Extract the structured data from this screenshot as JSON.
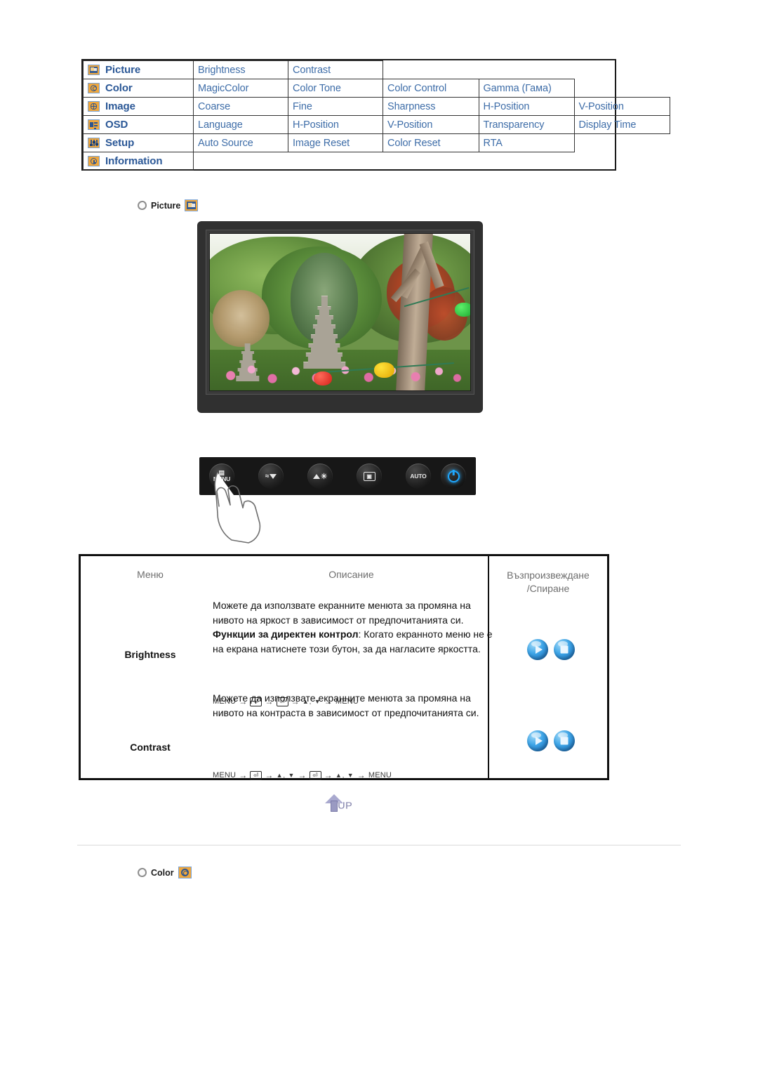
{
  "menu_map": {
    "rows": [
      {
        "category": "Picture",
        "icon": "picture-icon",
        "items": [
          "Brightness",
          "Contrast"
        ]
      },
      {
        "category": "Color",
        "icon": "color-icon",
        "items": [
          "MagicColor",
          "Color Tone",
          "Color Control",
          "Gamma (Гама)"
        ]
      },
      {
        "category": "Image",
        "icon": "image-icon",
        "items": [
          "Coarse",
          "Fine",
          "Sharpness",
          "H-Position",
          "V-Position"
        ]
      },
      {
        "category": "OSD",
        "icon": "osd-icon",
        "items": [
          "Language",
          "H-Position",
          "V-Position",
          "Transparency",
          "Display Time"
        ]
      },
      {
        "category": "Setup",
        "icon": "setup-icon",
        "items": [
          "Auto Source",
          "Image Reset",
          "Color Reset",
          "RTA"
        ]
      },
      {
        "category": "Information",
        "icon": "information-icon",
        "items": []
      }
    ],
    "link_color": "#3e6da8"
  },
  "section_picture": {
    "label": "Picture",
    "icon": "picture-icon",
    "bullet": "gem-bullet-icon"
  },
  "section_color": {
    "label": "Color",
    "icon": "color-icon",
    "bullet": "gem-bullet-icon"
  },
  "monitor": {
    "screen_alt": "garden scene with stone pagoda, trees and paper lanterns"
  },
  "button_bar": {
    "buttons": [
      {
        "name": "menu-button",
        "label": "MENU"
      },
      {
        "name": "down-button",
        "label": ""
      },
      {
        "name": "brightness-button",
        "label": ""
      },
      {
        "name": "enter-button",
        "label": ""
      },
      {
        "name": "auto-button",
        "label": "AUTO"
      },
      {
        "name": "power-button",
        "label": ""
      }
    ],
    "power_led_color": "#1fa8ff"
  },
  "desc_table": {
    "headers": {
      "menu": "Меню",
      "description": "Описание",
      "play_stop": "Възпроизвеждане\n/Спиране"
    },
    "rows": [
      {
        "label": "Brightness",
        "text_1": "Можете да използвате екранните менюта за промяна на нивото на яркост в зависимост от предпочитанията си.",
        "text_bold": "Функции за директен контрол",
        "text_2": ": Когато екранното меню не е на екрана натиснете този бутон, за да нагласите яркостта.",
        "key_sequence": [
          "MENU",
          "→",
          "⏎",
          "→",
          "⏎",
          "→",
          "▲, ▼",
          "→",
          "MENU"
        ],
        "key_sequence_text": "[MENU → ⏎ → ⏎ → ▲, ▼ → MENU]"
      },
      {
        "label": "Contrast",
        "text_1": "Можете да използвате екранните менюта за промяна на нивото на контраста в зависимост от предпочитанията си.",
        "text_bold": "",
        "text_2": "",
        "key_sequence": [
          "MENU",
          "→",
          "⏎",
          "→",
          "▲, ▼",
          "→",
          "⏎",
          "→",
          "▲, ▼",
          "→",
          "MENU"
        ],
        "key_sequence_text": "[MENU → ⏎ → ▲, ▼ → ⏎ → ▲, ▼ → MENU]"
      }
    ],
    "play_icon": "play-orb-icon",
    "stop_icon": "stop-orb-icon"
  },
  "up_button": {
    "label": "UP",
    "icon": "up-arrow-icon"
  }
}
